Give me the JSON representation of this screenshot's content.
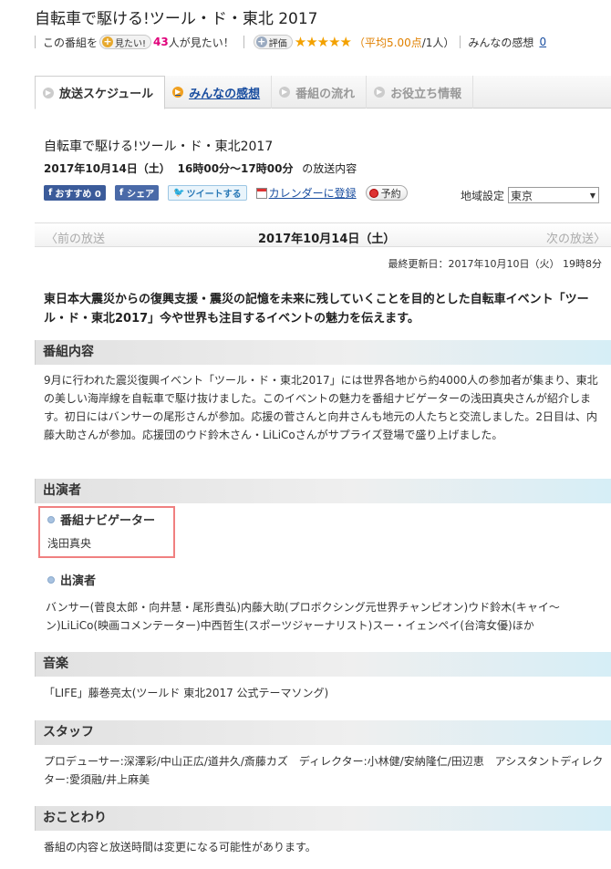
{
  "header": {
    "title": "自転車で駆ける!ツール・ド・東北 2017",
    "watch_prefix": "この番組を",
    "watch_button": "見たい!",
    "watch_count": "43",
    "watch_suffix": "人が見たい！",
    "rating_button": "評価",
    "stars": "★★★★★",
    "rating_avg": "（平均5.00点",
    "rating_count": "/1人）",
    "review_label": "みんなの感想",
    "review_count": "0"
  },
  "tabs": [
    {
      "label": "放送スケジュール",
      "active": true
    },
    {
      "label": "みんなの感想",
      "link": true
    },
    {
      "label": "番組の流れ"
    },
    {
      "label": "お役立ち情報"
    }
  ],
  "program": {
    "title": "自転車で駆ける!ツール・ド・東北2017",
    "date": "2017年10月14日（土）",
    "time": "16時00分～17時00分",
    "date_suffix": "の放送内容"
  },
  "buttons": {
    "fb_recommend": "おすすめ 0",
    "fb_share": "シェア",
    "tweet": "ツイートする",
    "calendar": "カレンダーに登録",
    "reserve": "予約"
  },
  "region": {
    "label": "地域設定",
    "selected": "東京"
  },
  "nav": {
    "prev": "〈前の放送",
    "current": "2017年10月14日（土）",
    "next": "次の放送〉"
  },
  "updated": "最終更新日：2017年10月10日（火） 19時8分",
  "lead": "東日本大震災からの復興支援・震災の記憶を未来に残していくことを目的とした自転車イベント「ツール・ド・東北2017」今や世界も注目するイベントの魅力を伝えます。",
  "sections": {
    "content_heading": "番組内容",
    "content_body": "9月に行われた震災復興イベント「ツール・ド・東北2017」には世界各地から約4000人の参加者が集まり、東北の美しい海岸線を自転車で駆け抜けました。このイベントの魅力を番組ナビゲーターの浅田真央さんが紹介します。初日にはバンサーの尾形さんが参加。応援の菅さんと向井さんも地元の人たちと交流しました。2日目は、内藤大助さんが参加。応援団のウド鈴木さん・LiLiCoさんがサプライズ登場で盛り上げました。",
    "cast_heading": "出演者",
    "navigator_label": "番組ナビゲーター",
    "navigator_name": "浅田真央",
    "performers_label": "出演者",
    "performers_body": "バンサー(菅良太郎・向井慧・尾形貴弘)内藤大助(プロボクシング元世界チャンピオン)ウド鈴木(キャイ～ン)LiLiCo(映画コメンテーター)中西哲生(スポーツジャーナリスト)スー・イェンペイ(台湾女優)ほか",
    "music_heading": "音楽",
    "music_body": "「LIFE」藤巻亮太(ツールド 東北2017 公式テーマソング)",
    "staff_heading": "スタッフ",
    "staff_body": "プロデューサー:深澤彩/中山正広/道井久/斎藤カズ　ディレクター:小林健/安納隆仁/田辺恵　アシスタントディレクター:愛須融/井上麻美",
    "notice_heading": "おことわり",
    "notice_body": "番組の内容と放送時間は変更になる可能性があります。"
  }
}
